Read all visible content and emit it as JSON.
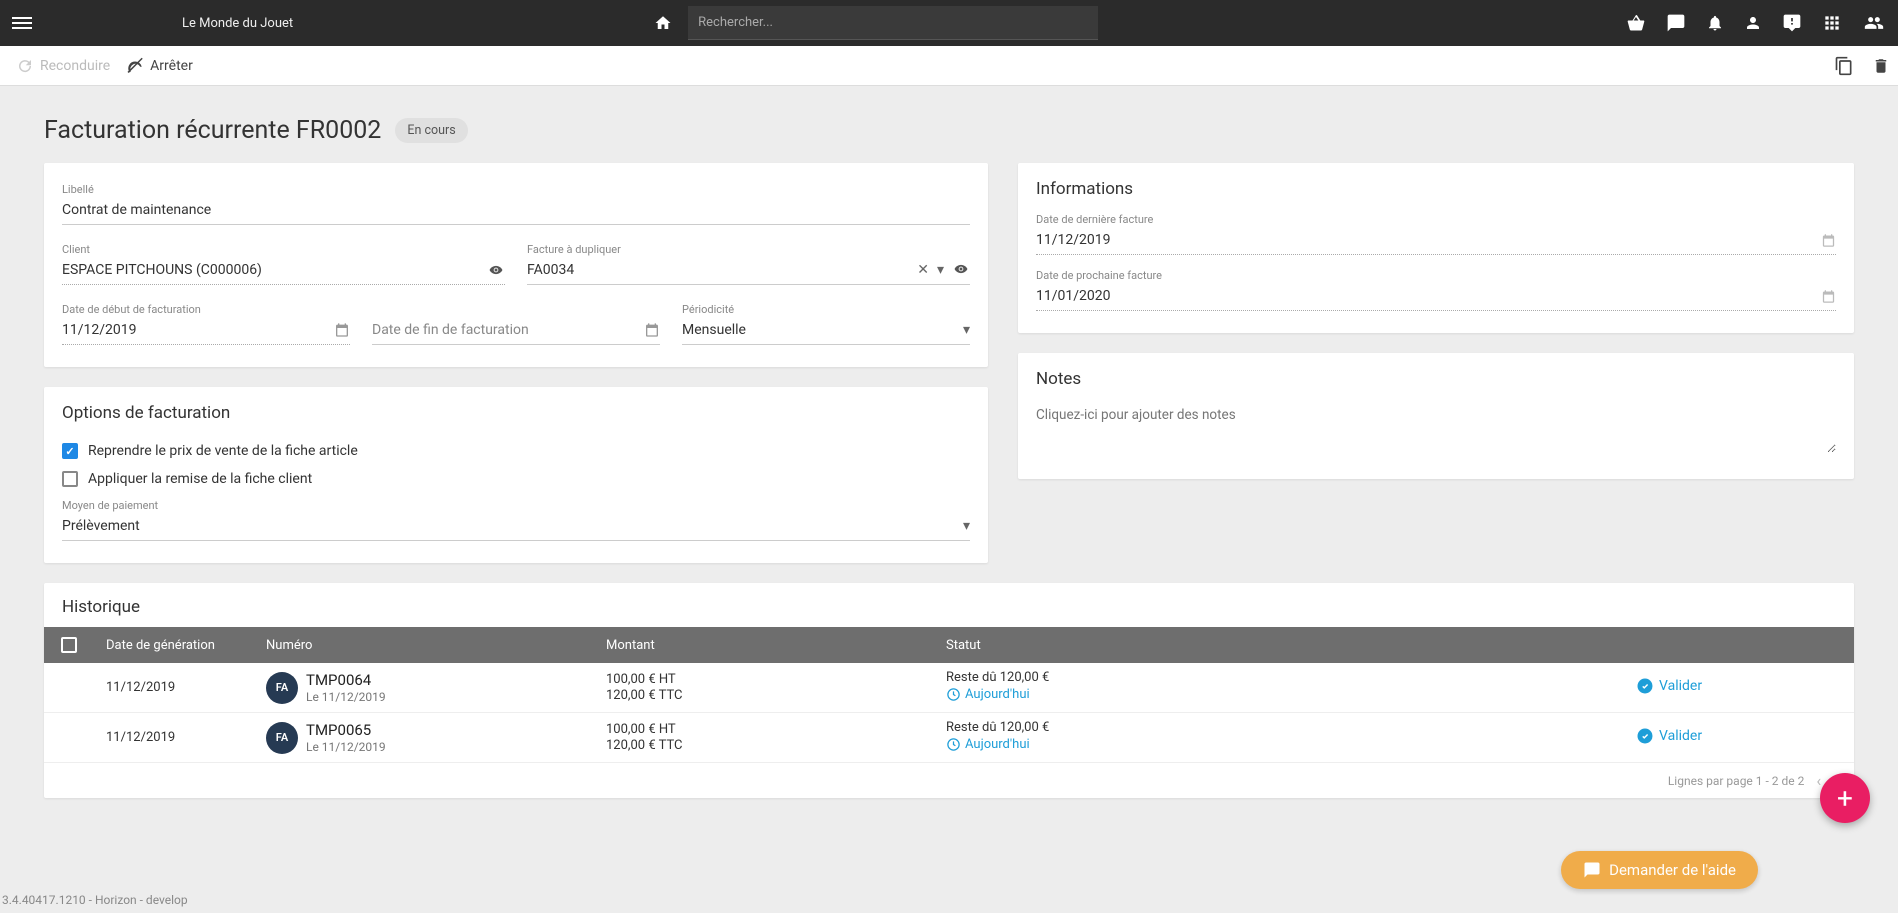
{
  "brand": "Le Monde du Jouet",
  "search_placeholder": "Rechercher...",
  "actions": {
    "reconduire": "Reconduire",
    "arreter": "Arrêter"
  },
  "title": "Facturation récurrente FR0002",
  "status_chip": "En cours",
  "form": {
    "libelle_label": "Libellé",
    "libelle": "Contrat de maintenance",
    "client_label": "Client",
    "client": "ESPACE PITCHOUNS (C000006)",
    "dup_label": "Facture à dupliquer",
    "dup": "FA0034",
    "start_label": "Date de début de facturation",
    "start": "11/12/2019",
    "end_label": "Date de fin de facturation",
    "period_label": "Périodicité",
    "period": "Mensuelle"
  },
  "options": {
    "title": "Options de facturation",
    "cb1": "Reprendre le prix de vente de la fiche article",
    "cb2": "Appliquer la remise de la fiche client",
    "pay_label": "Moyen de paiement",
    "pay": "Prélèvement"
  },
  "info": {
    "title": "Informations",
    "last_label": "Date de dernière facture",
    "last": "11/12/2019",
    "next_label": "Date de prochaine facture",
    "next": "11/01/2020"
  },
  "notes": {
    "title": "Notes",
    "placeholder": "Cliquez-ici pour ajouter des notes"
  },
  "history": {
    "title": "Historique",
    "cols": {
      "date": "Date de génération",
      "num": "Numéro",
      "amt": "Montant",
      "status": "Statut"
    },
    "rows": [
      {
        "date": "11/12/2019",
        "badge": "FA",
        "num": "TMP0064",
        "sub": "Le 11/12/2019",
        "ht": "100,00 € HT",
        "ttc": "120,00 € TTC",
        "rest": "Reste dû 120,00 €",
        "today": "Aujourd'hui",
        "action": "Valider"
      },
      {
        "date": "11/12/2019",
        "badge": "FA",
        "num": "TMP0065",
        "sub": "Le 11/12/2019",
        "ht": "100,00 € HT",
        "ttc": "120,00 € TTC",
        "rest": "Reste dû 120,00 €",
        "today": "Aujourd'hui",
        "action": "Valider"
      }
    ],
    "footer": "Lignes par page 1 - 2 de 2"
  },
  "help": "Demander de l'aide",
  "version": "3.4.40417.1210 - Horizon - develop"
}
